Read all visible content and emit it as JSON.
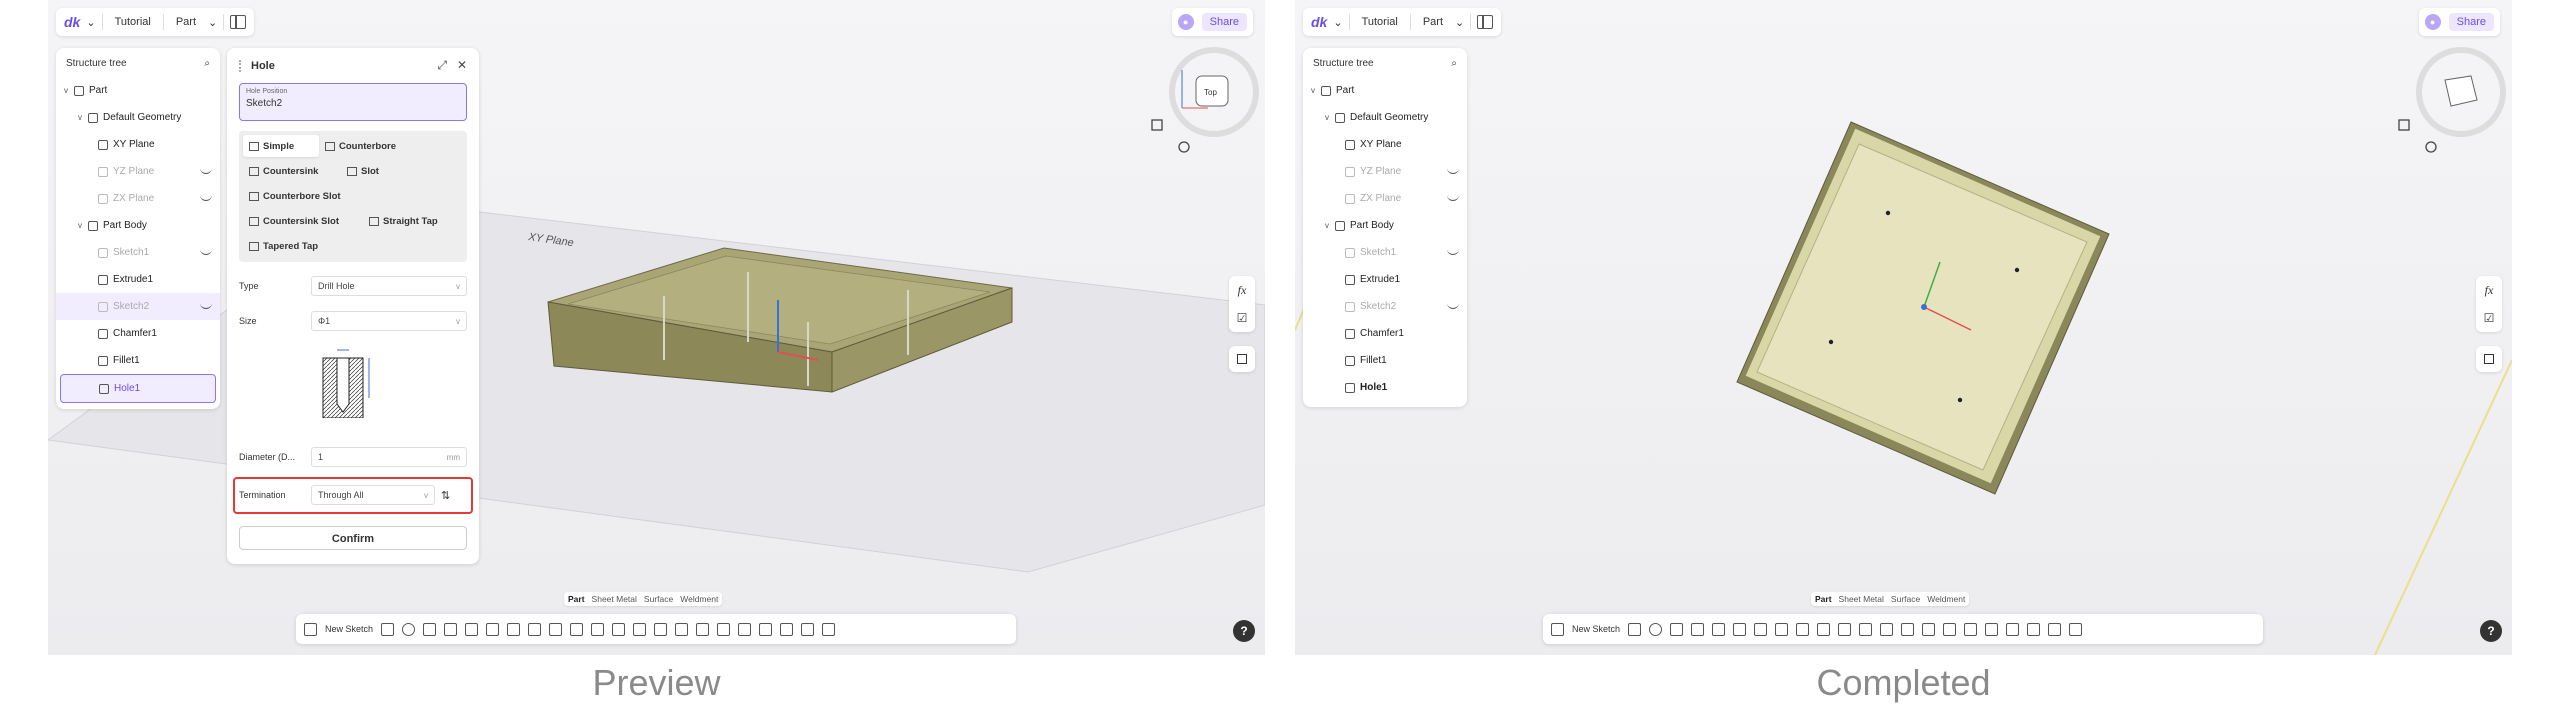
{
  "captions": {
    "left": "Preview",
    "right": "Completed"
  },
  "topbar": {
    "app": "Tutorial",
    "mode": "Part",
    "dropdown": "⌄"
  },
  "topright": {
    "avatar": "●",
    "share": "Share"
  },
  "tree": {
    "title": "Structure tree",
    "items": [
      {
        "label": "Part"
      },
      {
        "label": "Default Geometry"
      },
      {
        "label": "XY Plane"
      },
      {
        "label": "YZ Plane"
      },
      {
        "label": "ZX Plane"
      },
      {
        "label": "Part Body"
      },
      {
        "label": "Sketch1"
      },
      {
        "label": "Extrude1"
      },
      {
        "label": "Sketch2"
      },
      {
        "label": "Chamfer1"
      },
      {
        "label": "Fillet1"
      },
      {
        "label": "Hole1"
      }
    ]
  },
  "hole": {
    "title": "Hole",
    "position_label": "Hole Position",
    "position_value": "Sketch2",
    "types": [
      "Simple",
      "Counterbore",
      "Countersink",
      "Slot",
      "Counterbore Slot",
      "Countersink Slot",
      "Straight Tap",
      "Tapered Tap"
    ],
    "type_label": "Type",
    "type_value": "Drill Hole",
    "size_label": "Size",
    "size_value": "Φ1",
    "diameter_label": "Diameter (D...",
    "diameter_value": "1",
    "diameter_unit": "mm",
    "termination_label": "Termination",
    "termination_value": "Through All",
    "confirm": "Confirm"
  },
  "viewport": {
    "plane_label": "XY Plane",
    "cube_face": "Top"
  },
  "mode_tabs": [
    "Part",
    "Sheet Metal",
    "Surface",
    "Weldment"
  ],
  "toolbar": {
    "new_sketch": "New Sketch"
  },
  "right_tools": {
    "fx": "fx"
  },
  "help": "?"
}
